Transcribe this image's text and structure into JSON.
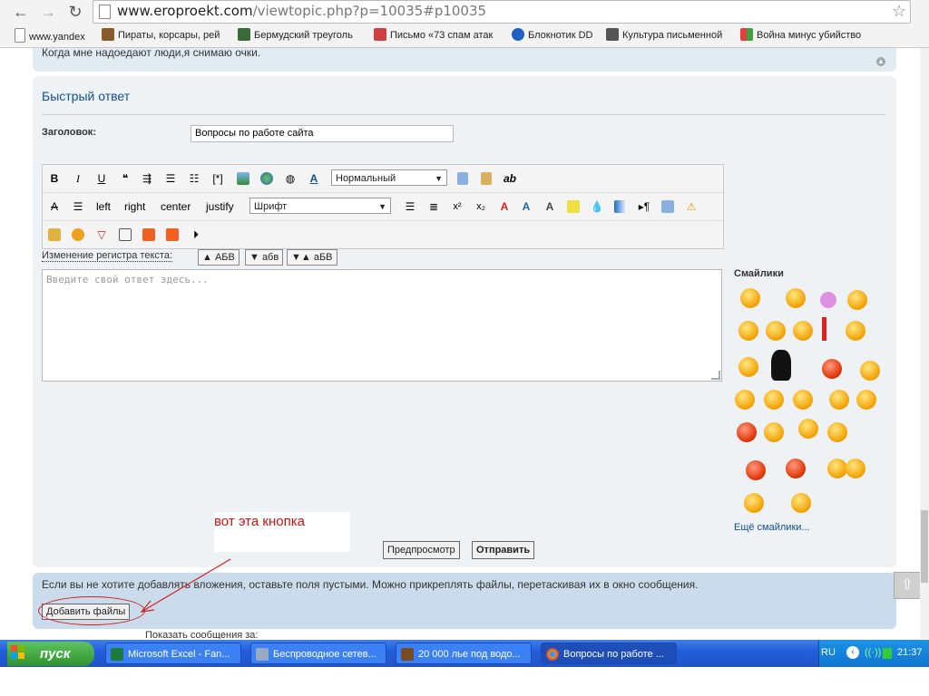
{
  "browser": {
    "url_host": "www.eroproekt.com",
    "url_path": "/viewtopic.php?p=10035#p10035",
    "bookmarks": [
      {
        "label": "www.yandex",
        "color": "#ffffff"
      },
      {
        "label": "Пираты, корсары, рей",
        "color": "#8a5a2a"
      },
      {
        "label": "Бермудский треуголь",
        "color": "#3a6a3a"
      },
      {
        "label": "Письмо «73 спам атак",
        "color": "#d04040"
      },
      {
        "label": "Блокнотик DD",
        "color": "#2060c0"
      },
      {
        "label": "Культура письменной",
        "color": "#555555"
      },
      {
        "label": "Война минус убийство",
        "color": "#40a040"
      }
    ]
  },
  "previous_post": {
    "text": "Когда мне надоедают люди,я снимаю очки."
  },
  "quick_reply": {
    "title": "Быстрый ответ",
    "subject_label": "Заголовок:",
    "subject_value": "Вопросы по работе сайта",
    "toolbar_row1": {
      "bold": "B",
      "italic": "I",
      "underline": "U",
      "font_size": "Нормальный",
      "ab": "ab"
    },
    "toolbar_row2": {
      "strike": "A",
      "left": "left",
      "right": "right",
      "center": "center",
      "justify": "justify",
      "font": "Шрифт",
      "sup": "x²",
      "sub": "x₂"
    },
    "case_label": "Изменение регистра текста:",
    "case_buttons": [
      "▲ АБВ",
      "▼ абв",
      "▼▲ аБВ"
    ],
    "message_placeholder": "Введите свой ответ здесь...",
    "smilies_title": "Смайлики",
    "more_smilies": "Ещё смайлики...",
    "preview_button": "Предпросмотр",
    "submit_button": "Отправить"
  },
  "attachments": {
    "text": "Если вы не хотите добавлять вложения, оставьте поля пустыми. Можно прикреплять файлы, перетаскивая их в окно сообщения.",
    "add_files_button": "Добавить файлы"
  },
  "annotation": {
    "text": "вот эта кнопка",
    "color": "#d01010"
  },
  "bottom_row": {
    "text": "Показать сообщения за:"
  },
  "taskbar": {
    "start_label": "пуск",
    "tasks": [
      {
        "label": "Microsoft Excel - Fan...",
        "color": "#1d7a3a"
      },
      {
        "label": "Беспроводное сетев...",
        "color": "#9aa8c0"
      },
      {
        "label": "20 000 лье под водо...",
        "color": "#7a4a20"
      },
      {
        "label": "Вопросы по работе ...",
        "color": "#e0a020"
      }
    ],
    "language": "RU",
    "clock": "21:37"
  }
}
